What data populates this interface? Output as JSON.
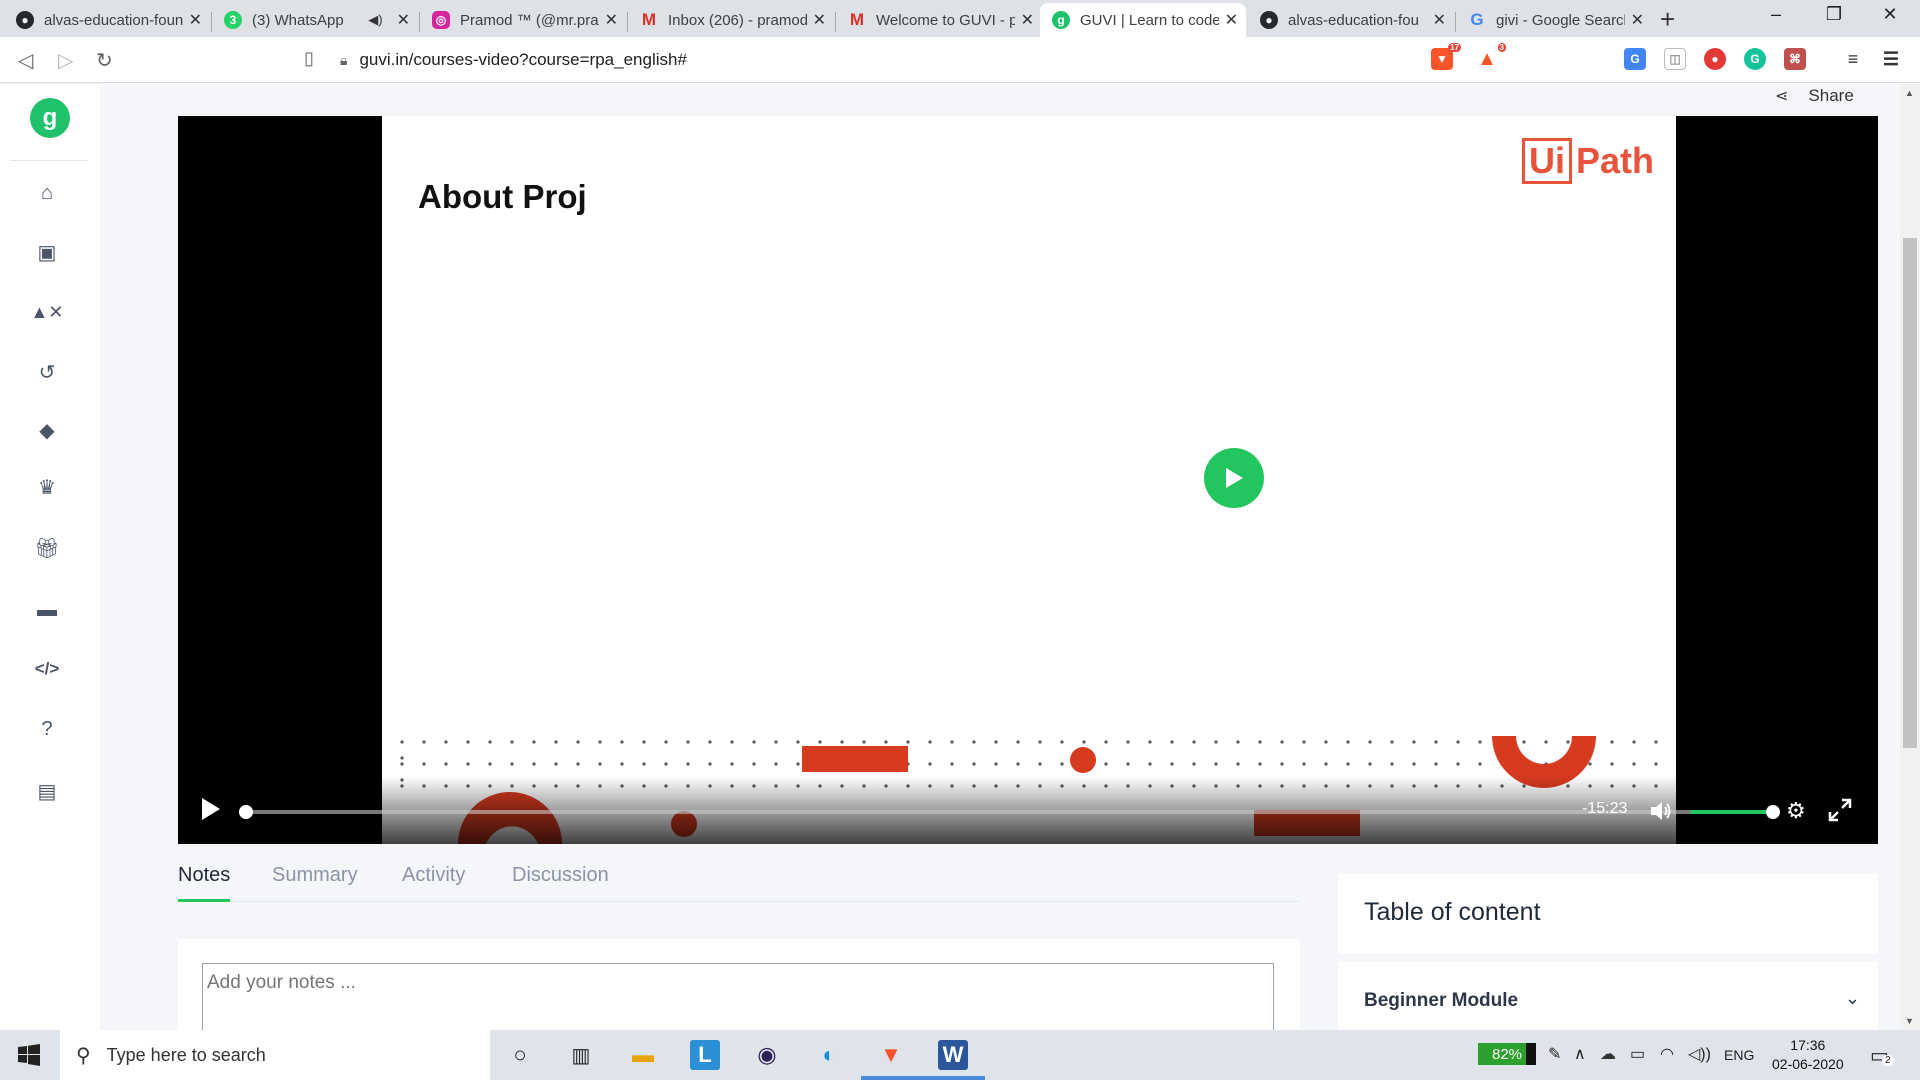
{
  "browser": {
    "tabs": [
      {
        "title": "alvas-education-foun",
        "favicon": "github-icon",
        "color": "#24292e"
      },
      {
        "title": "(3) WhatsApp",
        "favicon": "whatsapp-icon",
        "color": "#25d366"
      },
      {
        "title": "Pramod ™ (@mr.pra",
        "favicon": "instagram-icon",
        "color": "#d6249f"
      },
      {
        "title": "Inbox (206) - pramod",
        "favicon": "gmail-icon",
        "color": "#d93025"
      },
      {
        "title": "Welcome to GUVI - p",
        "favicon": "gmail-icon",
        "color": "#d93025"
      },
      {
        "title": "GUVI | Learn to code",
        "favicon": "guvi-icon",
        "color": "#1fc16b"
      },
      {
        "title": "alvas-education-fou",
        "favicon": "github-icon",
        "color": "#24292e"
      },
      {
        "title": "givi - Google Search",
        "favicon": "google-icon",
        "color": "#4285f4"
      }
    ],
    "url": "guvi.in/courses-video?course=rpa_english#",
    "brave_badge": "17",
    "rewards_badge": "3"
  },
  "page": {
    "logo_letter": "g",
    "share_label": "Share",
    "sidebar_icons": [
      "home-icon",
      "video-library-icon",
      "shapes-icon",
      "refresh-icon",
      "tag-icon",
      "crown-icon",
      "gift-icon",
      "briefcase-icon",
      "code-icon",
      "help-icon",
      "chat-icon"
    ]
  },
  "video": {
    "slide_title": "About Proj",
    "brand_box": "Ui",
    "brand_text": "Path",
    "time_remaining": "-15:23",
    "progress": 0.0,
    "volume": 1.0
  },
  "tabs_section": {
    "tabs": [
      "Notes",
      "Summary",
      "Activity",
      "Discussion"
    ],
    "active": "Notes",
    "notes_placeholder": "Add your notes ..."
  },
  "toc": {
    "title": "Table of content",
    "module": "Beginner Module"
  },
  "taskbar": {
    "search_placeholder": "Type here to search",
    "battery": "82%",
    "battery_level": 0.82,
    "language": "ENG",
    "time": "17:36",
    "date": "02-06-2020",
    "notifications": "2"
  },
  "colors": {
    "accent": "#22c55e",
    "uipath": "#e8533b"
  }
}
